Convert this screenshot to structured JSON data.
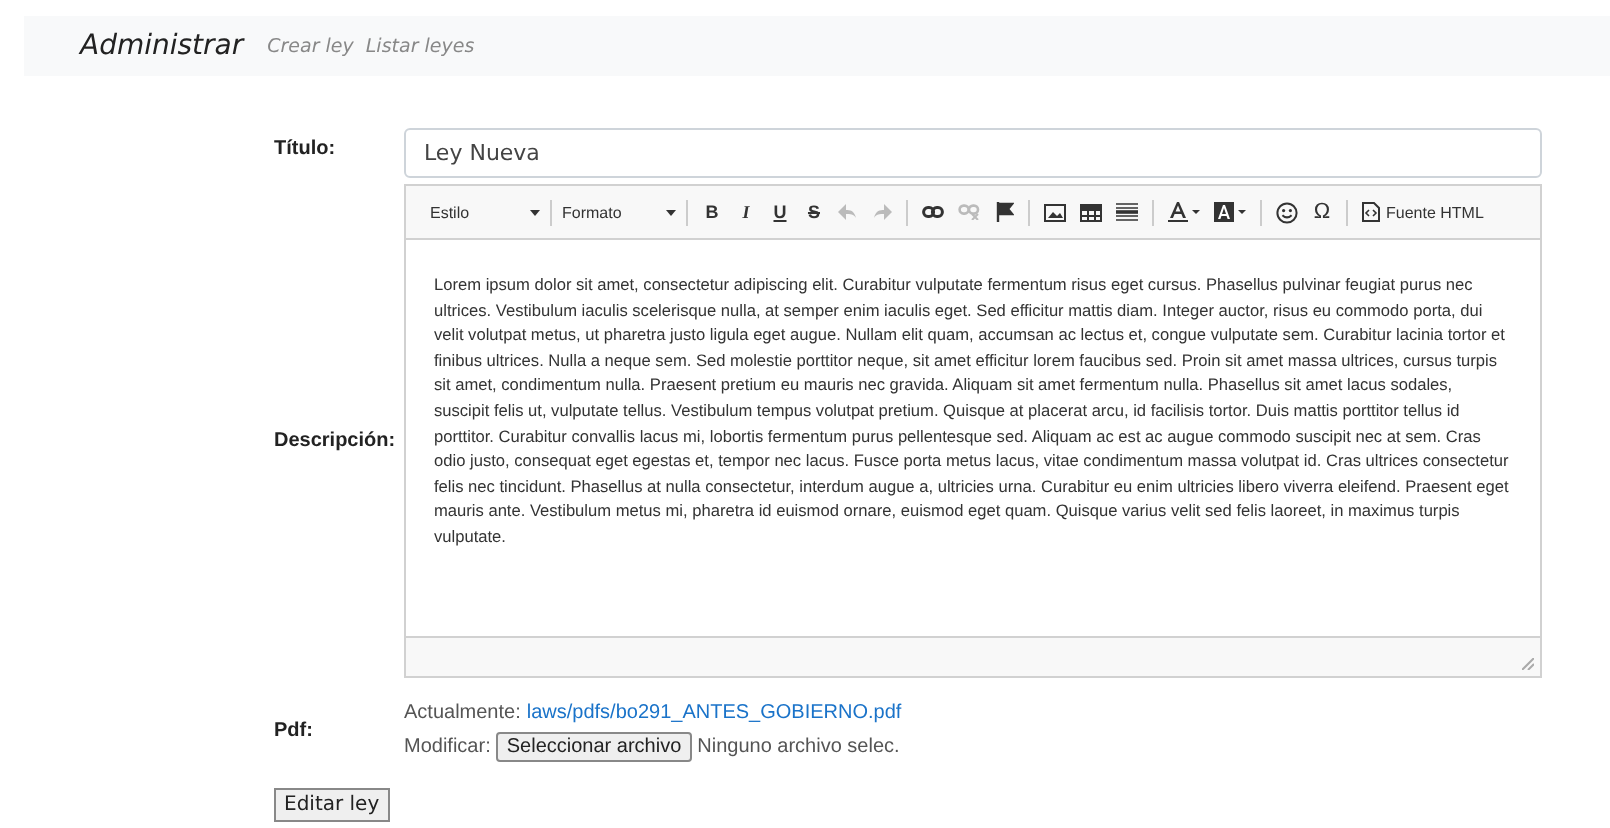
{
  "navbar": {
    "brand": "Administrar",
    "links": [
      {
        "label": "Crear ley"
      },
      {
        "label": "Listar leyes"
      }
    ]
  },
  "form": {
    "title_label": "Título:",
    "title_value": "Ley Nueva",
    "description_label": "Descripción:",
    "toolbar": {
      "style_dropdown": "Estilo",
      "format_dropdown": "Formato",
      "bold": "B",
      "italic": "I",
      "underline": "U",
      "strike": "S",
      "undo": {
        "disabled": true
      },
      "redo": {
        "disabled": true
      },
      "unlink": {
        "disabled": true
      },
      "special_char": "Ω",
      "source": "Fuente HTML"
    },
    "description": "Lorem ipsum dolor sit amet, consectetur adipiscing elit. Curabitur vulputate fermentum risus eget cursus. Phasellus pulvinar feugiat purus nec ultrices. Vestibulum iaculis scelerisque nulla, at semper enim iaculis eget. Sed efficitur mattis diam. Integer auctor, risus eu commodo porta, dui velit volutpat metus, ut pharetra justo ligula eget augue. Nullam elit quam, accumsan ac lectus et, congue vulputate sem. Curabitur lacinia tortor et finibus ultrices. Nulla a neque sem. Sed molestie porttitor neque, sit amet efficitur lorem faucibus sed. Proin sit amet massa ultrices, cursus turpis sit amet, condimentum nulla. Praesent pretium eu mauris nec gravida. Aliquam sit amet fermentum nulla. Phasellus sit amet lacus sodales, suscipit felis ut, vulputate tellus. Vestibulum tempus volutpat pretium. Quisque at placerat arcu, id facilisis tortor. Duis mattis porttitor tellus id porttitor. Curabitur convallis lacus mi, lobortis fermentum purus pellentesque sed. Aliquam ac est ac augue commodo suscipit nec at sem. Cras odio justo, consequat eget egestas et, tempor nec lacus. Fusce porta metus lacus, vitae condimentum massa volutpat id. Cras ultrices consectetur felis nec tincidunt. Phasellus at nulla consectetur, interdum augue a, ultricies urna. Curabitur eu enim ultricies libero viverra eleifend. Praesent eget mauris ante. Vestibulum metus mi, pharetra id euismod ornare, euismod eget quam. Quisque varius velit sed felis laoreet, in maximus turpis vulputate.",
    "pdf_label": "Pdf:",
    "current_label": "Actualmente:",
    "current_link": "laws/pdfs/bo291_ANTES_GOBIERNO.pdf",
    "modify_label": "Modificar:",
    "file_button": "Seleccionar archivo",
    "file_status": "Ninguno archivo selec.",
    "submit": "Editar ley"
  }
}
